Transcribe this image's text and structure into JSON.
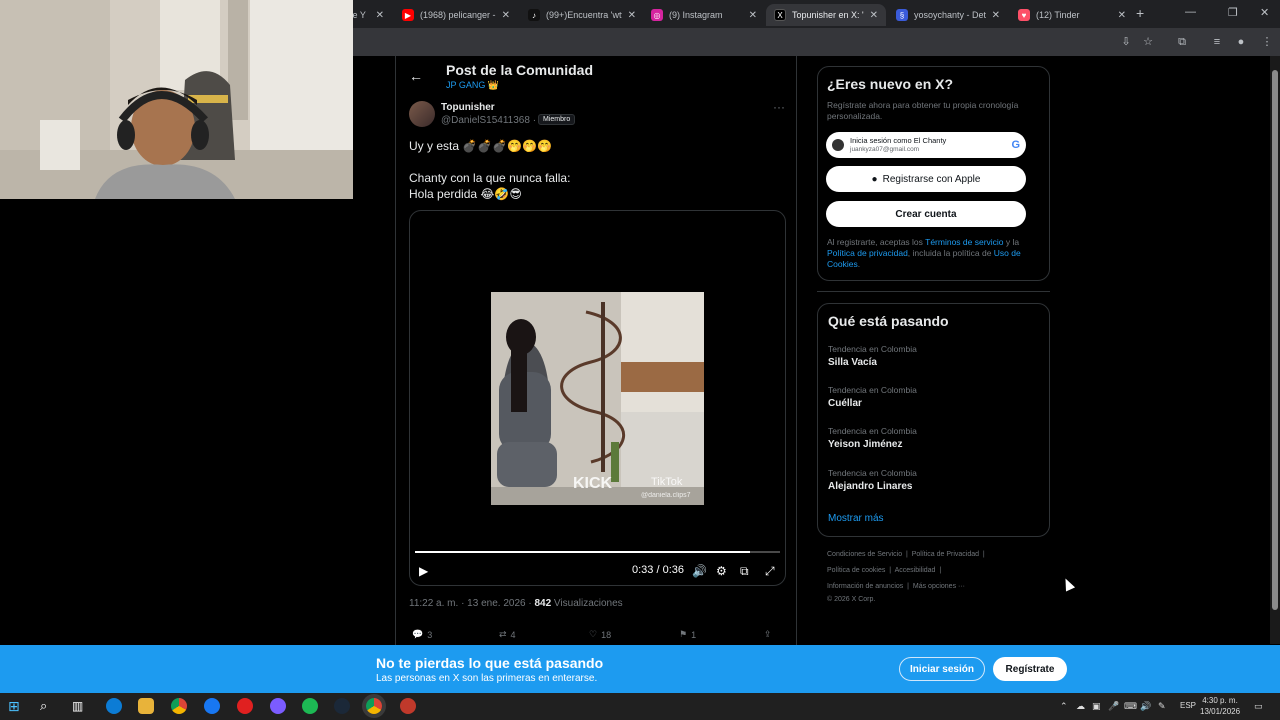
{
  "browser": {
    "tabs": [
      {
        "title": "ke Y",
        "fav": "",
        "color": "#888"
      },
      {
        "title": "(1968) pelicanger - Y",
        "fav": "▶",
        "color": "#ff0000"
      },
      {
        "title": "(99+)Encuentra 'wtf' g",
        "fav": "♪",
        "color": "#000"
      },
      {
        "title": "(9) Instagram",
        "fav": "◎",
        "color": "#d6249f"
      },
      {
        "title": "Topunisher en X: \"Uy",
        "fav": "X",
        "color": "#000"
      },
      {
        "title": "yosoychanty - Detail",
        "fav": "§",
        "color": "#3a5bd9"
      },
      {
        "title": "(12) Tinder",
        "fav": "♥",
        "color": "#fd5068"
      }
    ]
  },
  "post": {
    "header_title": "Post de la Comunidad",
    "community": "JP GANG 👑",
    "author_name": "Topunisher",
    "author_handle": "@DanielS15411368 ·",
    "member_badge": "Miembro",
    "text_line1": "Uy y esta 💣💣💣🤭🤭🤭",
    "text_line2": "Chanty con la que nunca falla:",
    "text_line3": "Hola perdida 😂🤣😎",
    "video_time": "0:33 / 0:36",
    "video_progress": 0.917,
    "watermark_kick": "KICK",
    "watermark_tiktok": "TikTok",
    "watermark_user": "@daniela.clips7",
    "timestamp": "11:22 a. m. · 13 ene. 2026 ·",
    "views_count": "842",
    "views_label": "Visualizaciones",
    "replies": "3",
    "reposts": "4",
    "likes": "18",
    "bookmarks": "1"
  },
  "signup": {
    "title": "¿Eres nuevo en X?",
    "subtitle": "Regístrate ahora para obtener tu propia cronología personalizada.",
    "google_line1": "Inicia sesión como El Chanty",
    "google_line2": "juankyza07@gmail.com",
    "apple_label": "Registrarse con Apple",
    "create_label": "Crear cuenta",
    "legal_1": "Al registrarte, aceptas los ",
    "legal_terms": "Términos de servicio",
    "legal_2": " y la ",
    "legal_privacy": "Política de privacidad",
    "legal_3": ", incluida la política de ",
    "legal_cookies": "Uso de Cookies",
    "legal_4": "."
  },
  "trends": {
    "title": "Qué está pasando",
    "items": [
      {
        "category": "Tendencia en Colombia",
        "name": "Silla Vacía"
      },
      {
        "category": "Tendencia en Colombia",
        "name": "Cuéllar"
      },
      {
        "category": "Tendencia en Colombia",
        "name": "Yeison Jiménez"
      },
      {
        "category": "Tendencia en Colombia",
        "name": "Alejandro Linares"
      }
    ],
    "show_more": "Mostrar más"
  },
  "footer": {
    "links_row1": [
      "Condiciones de Servicio",
      "Política de Privacidad"
    ],
    "links_row2": [
      "Política de cookies",
      "Accesibilidad"
    ],
    "links_row3": [
      "Información de anuncios",
      "Más opciones ···"
    ],
    "copyright": "© 2026 X Corp."
  },
  "banner": {
    "title": "No te pierdas lo que está pasando",
    "subtitle": "Las personas en X son las primeras en enterarse.",
    "login_label": "Iniciar sesión",
    "signup_label": "Regístrate"
  },
  "taskbar": {
    "lang": "ESP",
    "time": "4:30 p. m.",
    "date": "13/01/2026"
  }
}
